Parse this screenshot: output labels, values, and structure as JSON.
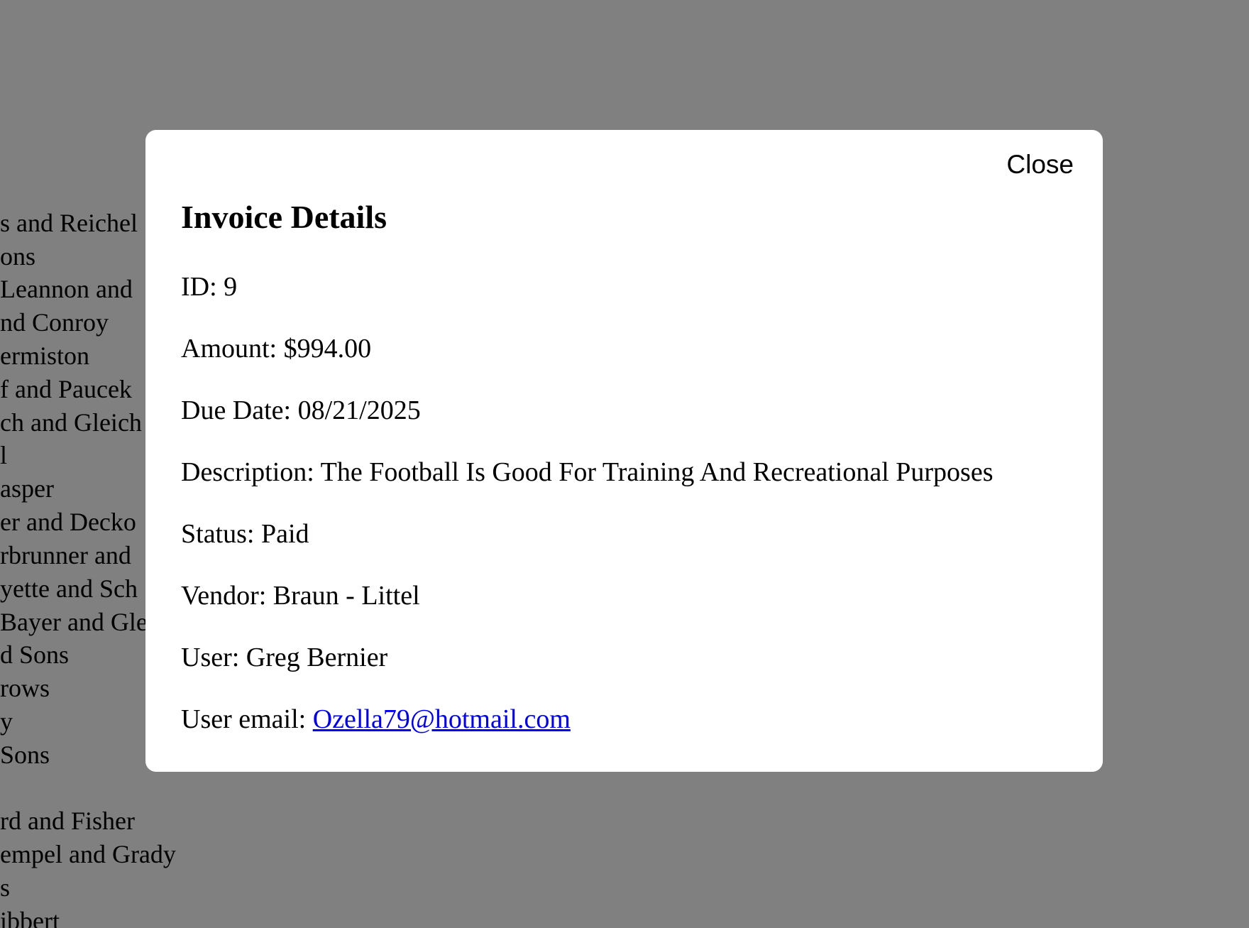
{
  "background": {
    "overlay_color": "#808080",
    "vendor_list": [
      "s and Reichel",
      "ons",
      "Leannon and",
      "nd Conroy",
      "ermiston",
      "f and Paucek",
      "ch and Gleich",
      "l",
      "asper",
      "er and Decko",
      "rbrunner and",
      "yette and Sch",
      "Bayer and Gle",
      "d Sons",
      "rows",
      "y",
      "Sons",
      "",
      "rd and Fisher",
      "empel and Grady",
      "s",
      "ibbert"
    ]
  },
  "modal": {
    "close_label": "Close",
    "title": "Invoice Details",
    "fields": {
      "id": "ID: 9",
      "amount": "Amount: $994.00",
      "due_date": "Due Date: 08/21/2025",
      "description": "Description: The Football Is Good For Training And Recreational Purposes",
      "status": "Status: Paid",
      "vendor": "Vendor: Braun - Littel",
      "user": "User: Greg Bernier",
      "user_email_label": "User email: ",
      "user_email": "Ozella79@hotmail.com"
    },
    "link_color": "#0000ee"
  }
}
